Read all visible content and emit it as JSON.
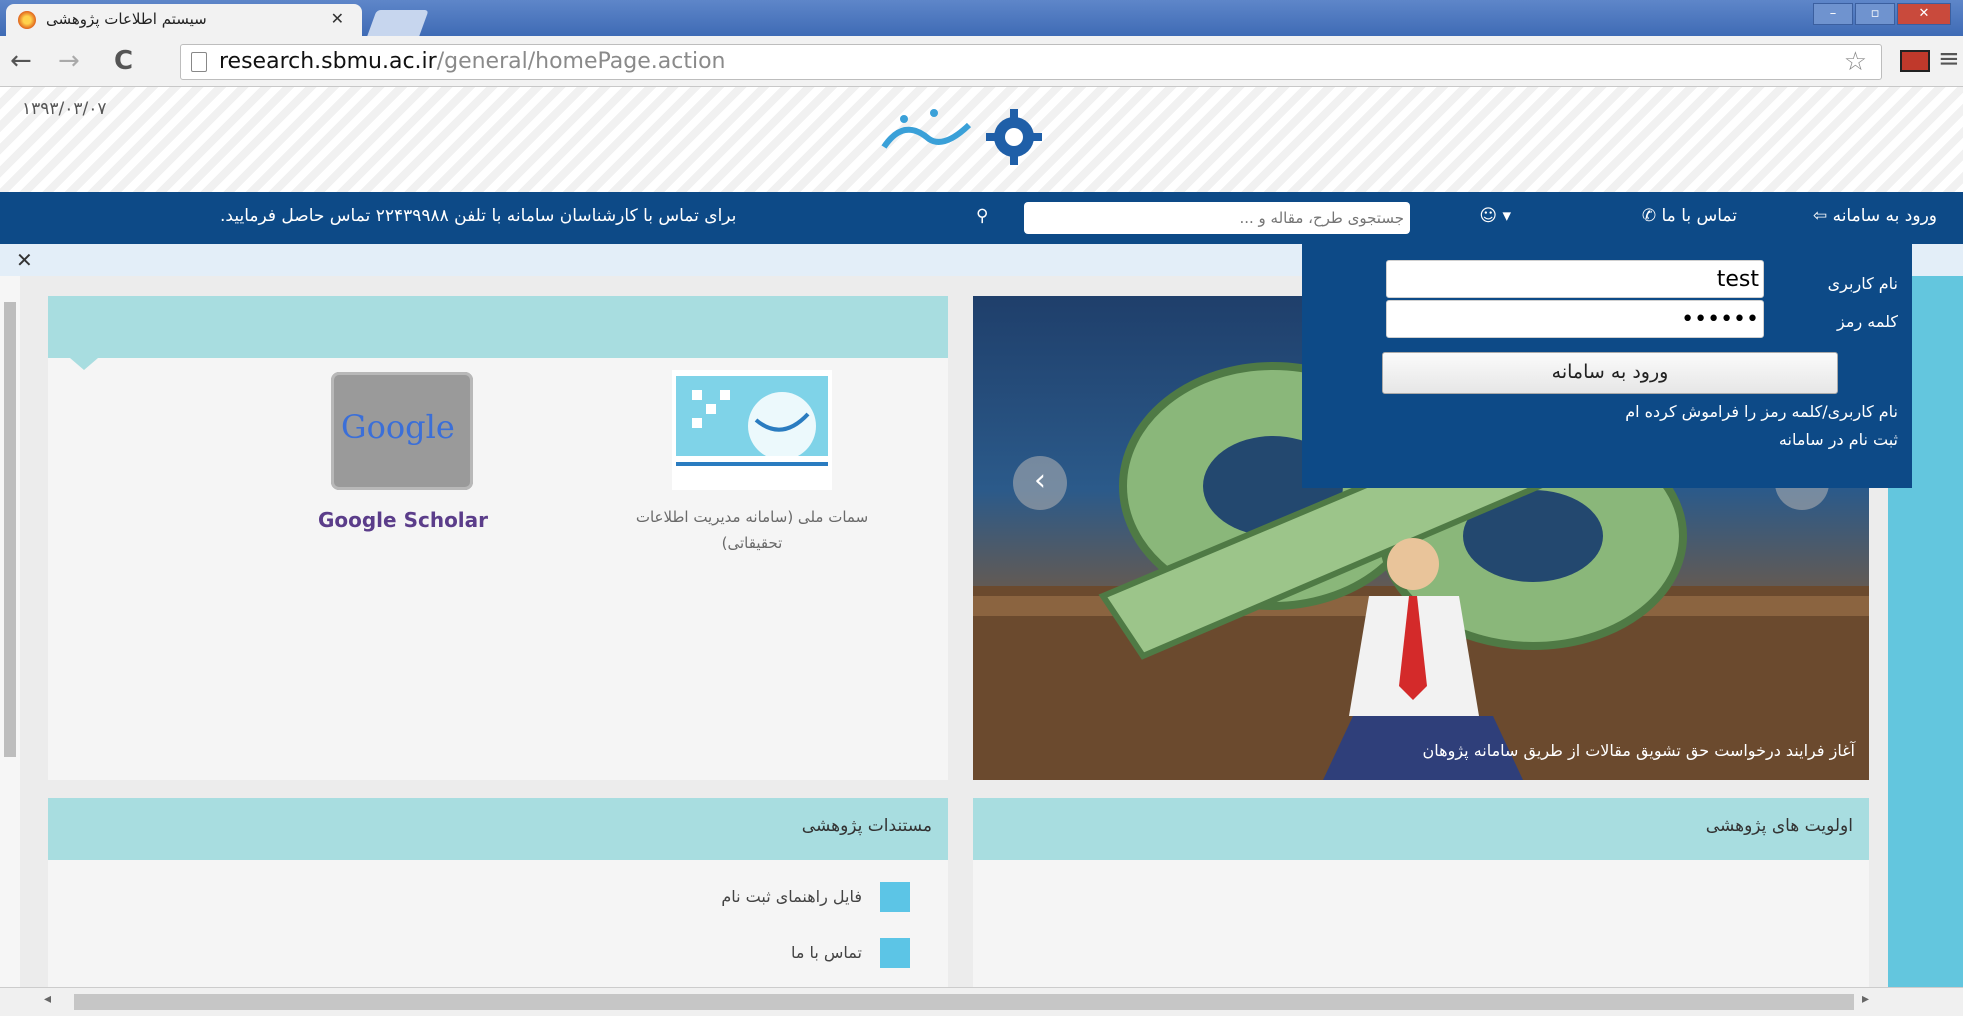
{
  "browser": {
    "tab_title": "سیستم اطلاعات پژوهشی",
    "url_host": "research.sbmu.ac.ir",
    "url_path": "/general/homePage.action"
  },
  "header": {
    "date": "۱۳۹۳/۰۳/۰۷"
  },
  "navbar": {
    "login_link": "ورود به سامانه",
    "contact_link": "تماس با ما",
    "search_placeholder": "جستجوی طرح، مقاله و ...",
    "contact_notice": "برای تماس با کارشناسان سامانه با تلفن ۲۲۴۳۹۹۸۸ تماس حاصل فرمایید."
  },
  "login": {
    "username_label": "نام کاربری",
    "username_value": "test",
    "password_label": "کلمه رمز",
    "password_value": "••••••",
    "submit_label": "ورود به سامانه",
    "forgot_link": "نام کاربری/کلمه رمز را فراموش کرده ام",
    "register_link": "ثبت نام در سامانه"
  },
  "slider": {
    "caption": "آغاز فرایند درخواست حق تشویق مقالات از طریق سامانه پژوهان"
  },
  "links_panel": {
    "samat_label": "سمات ملی (سامانه مدیریت اطلاعات تحقیقاتی)",
    "scholar_label": "Google Scholar",
    "scholar_logo_text": "Google"
  },
  "priorities_panel": {
    "title": "اولویت های پژوهشی"
  },
  "documents_panel": {
    "title": "مستندات پژوهشی",
    "items": [
      "فایل راهنمای ثبت نام",
      "تماس با ما"
    ]
  },
  "colors": {
    "navbar": "#0d4a87",
    "panel_header": "#a8dde0",
    "accent_strip": "#63c6de"
  }
}
